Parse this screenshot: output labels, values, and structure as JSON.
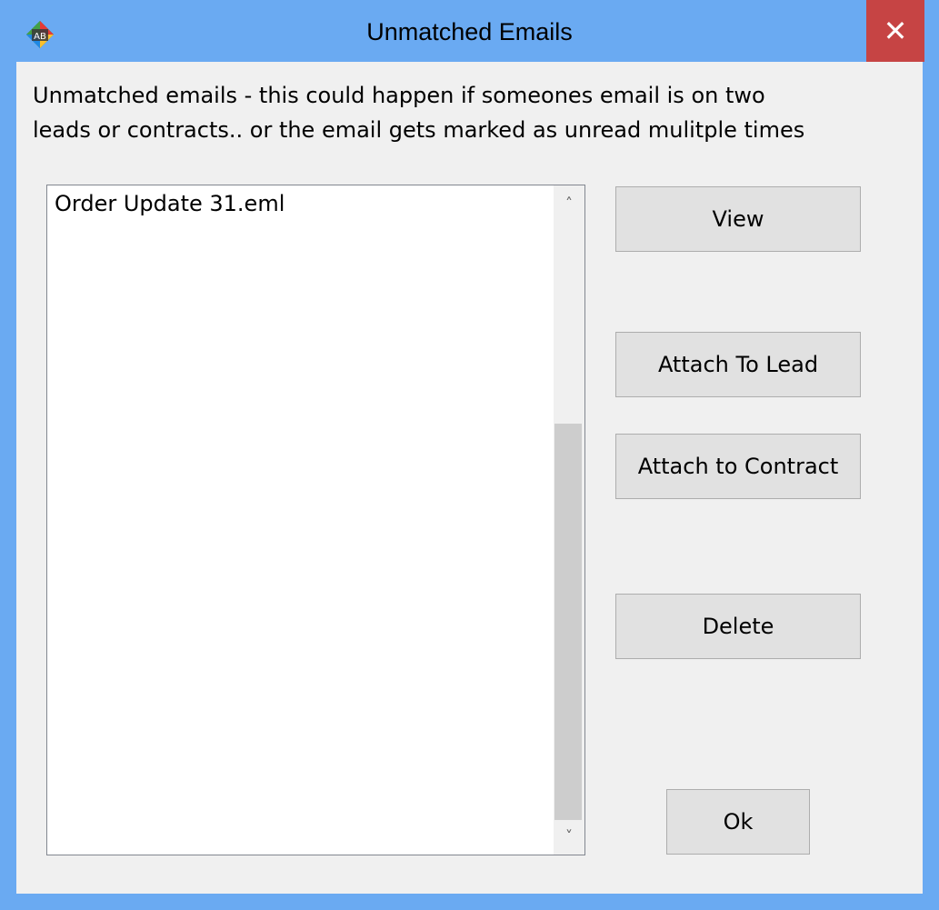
{
  "window": {
    "title": "Unmatched Emails",
    "close_label": "✕",
    "app_icon": "ab-app-icon",
    "app_icon_text": "AB",
    "accent_color": "#6aaaf2",
    "close_color": "#c64444"
  },
  "message": {
    "line1": "Unmatched emails - this could happen if someones email is on two",
    "line2": "leads or contracts.. or the email gets marked as unread mulitple times"
  },
  "email_list": {
    "items": [
      {
        "label": "Order Update 31.eml"
      }
    ],
    "scroll_up_icon": "chevron-up-icon",
    "scroll_down_icon": "chevron-down-icon",
    "scroll_up_glyph": "˄",
    "scroll_down_glyph": "˅"
  },
  "buttons": {
    "view": "View",
    "attach_lead": "Attach To Lead",
    "attach_contract": "Attach to Contract",
    "delete": "Delete",
    "ok": "Ok"
  }
}
